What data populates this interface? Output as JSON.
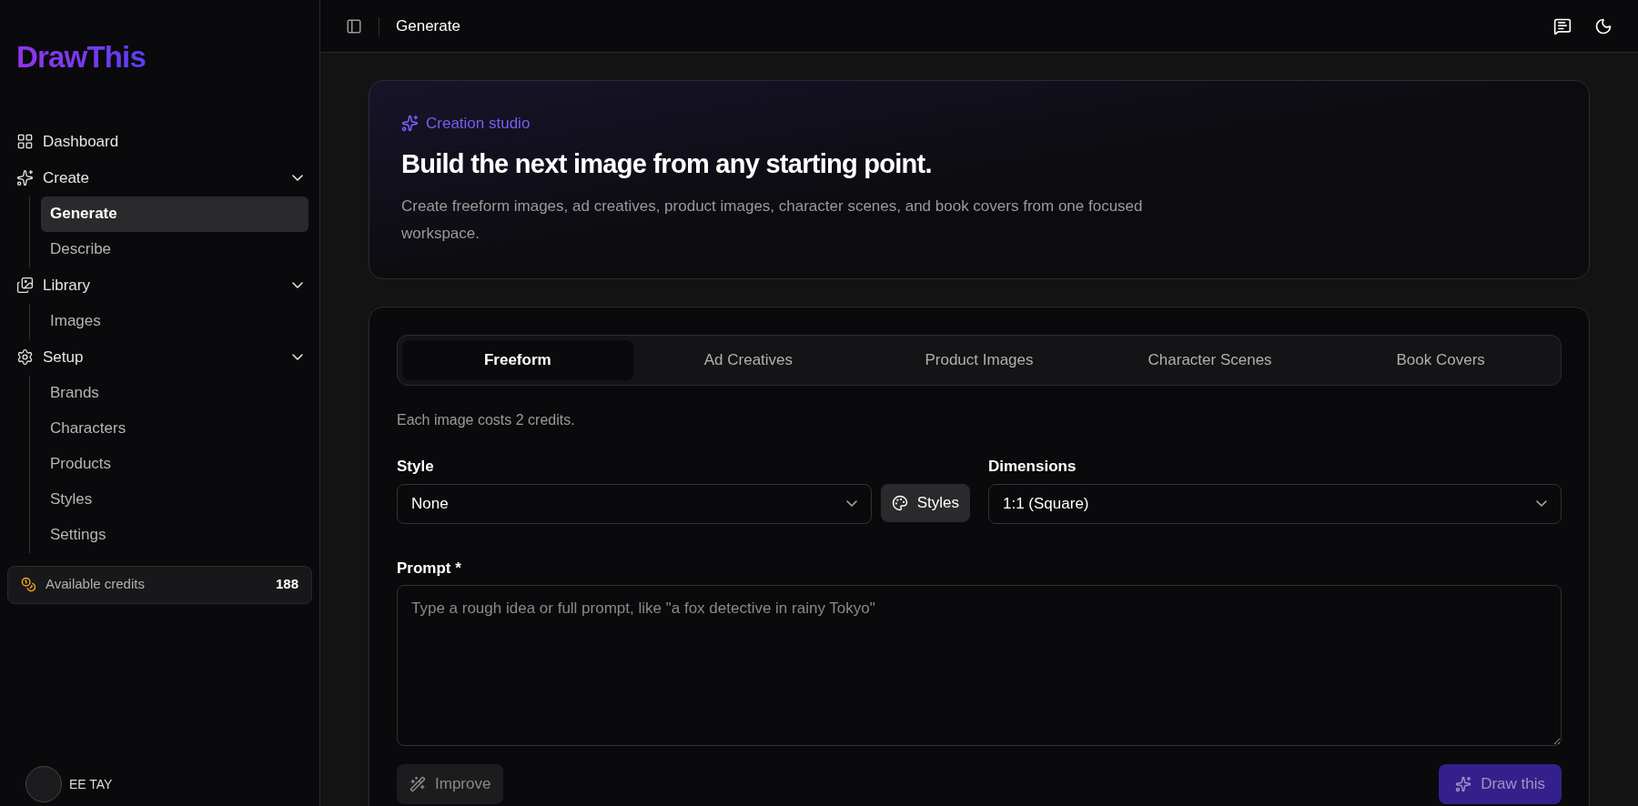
{
  "sidebar": {
    "logo": "DrawThis",
    "nav": [
      {
        "label": "Dashboard",
        "kind": "link"
      },
      {
        "label": "Create",
        "kind": "group",
        "expanded": true,
        "children": [
          {
            "label": "Generate",
            "selected": true
          },
          {
            "label": "Describe",
            "selected": false
          }
        ]
      },
      {
        "label": "Library",
        "kind": "group",
        "expanded": true,
        "children": [
          {
            "label": "Images",
            "selected": false
          }
        ]
      },
      {
        "label": "Setup",
        "kind": "group",
        "expanded": true,
        "children": [
          {
            "label": "Brands",
            "selected": false
          },
          {
            "label": "Characters",
            "selected": false
          },
          {
            "label": "Products",
            "selected": false
          },
          {
            "label": "Styles",
            "selected": false
          },
          {
            "label": "Settings",
            "selected": false
          }
        ]
      }
    ],
    "credits": {
      "label": "Available credits",
      "value": "188"
    },
    "user": {
      "name": "EE TAY"
    }
  },
  "header": {
    "title": "Generate"
  },
  "hero": {
    "eyebrow": "Creation studio",
    "title": "Build the next image from any starting point.",
    "description": "Create freeform images, ad creatives, product images, character scenes, and book covers from one focused workspace."
  },
  "form": {
    "tabs": [
      {
        "label": "Freeform",
        "selected": true
      },
      {
        "label": "Ad Creatives",
        "selected": false
      },
      {
        "label": "Product Images",
        "selected": false
      },
      {
        "label": "Character Scenes",
        "selected": false
      },
      {
        "label": "Book Covers",
        "selected": false
      }
    ],
    "cost_note": "Each image costs 2 credits.",
    "style": {
      "label": "Style",
      "value": "None",
      "button": "Styles"
    },
    "dimensions": {
      "label": "Dimensions",
      "value": "1:1 (Square)"
    },
    "prompt": {
      "label": "Prompt *",
      "placeholder": "Type a rough idea or full prompt, like \"a fox detective in rainy Tokyo\""
    },
    "improve": {
      "label": "Improve",
      "disabled": true
    },
    "submit": {
      "label": "Draw this",
      "disabled": true
    }
  }
}
